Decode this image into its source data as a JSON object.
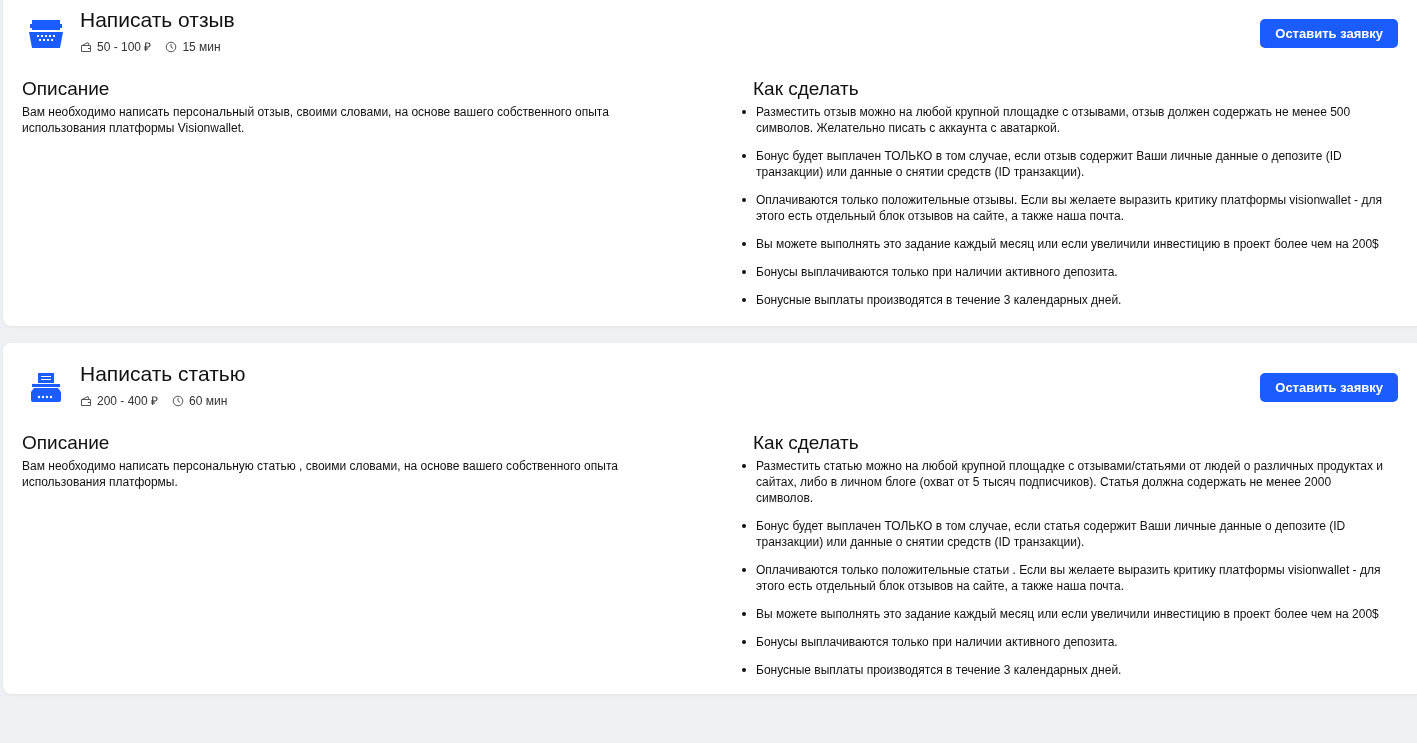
{
  "tasks": [
    {
      "icon": {
        "kind": "typewriter"
      },
      "title": "Написать отзыв",
      "reward": "50 - 100 ₽",
      "duration": "15 мин",
      "button": "Оставить заявку",
      "description_heading": "Описание",
      "description": "Вам необходимо написать персональный отзыв, своими словами, на основе вашего собственного опыта использования платформы Visionwallet.",
      "howto_heading": "Как сделать",
      "steps": [
        "Разместить отзыв можно на любой крупной площадке с отзывами, отзыв должен содержать не менее 500 символов. Желательно писать с аккаунта с аватаркой.",
        "Бонус будет выплачен ТОЛЬКО в том случае, если отзыв содержит Ваши личные данные о депозите (ID транзакции) или данные о снятии средств (ID транзакции).",
        "Оплачиваются только положительные отзывы. Если вы желаете выразить критику платформы visionwallet - для этого есть отдельный блок отзывов на сайте, а также наша почта.",
        "Вы можете выполнять это задание каждый месяц или если увеличили инвестицию в проект более чем на 200$",
        "Бонусы выплачиваются только при наличии активного депозита.",
        "Бонусные выплаты производятся в течение 3 календарных дней."
      ]
    },
    {
      "icon": {
        "kind": "printer"
      },
      "title": "Написать статью",
      "reward": "200 - 400 ₽",
      "duration": "60 мин",
      "button": "Оставить заявку",
      "description_heading": "Описание",
      "description": "Вам необходимо написать персональную статью , своими словами, на основе вашего собственного опыта использования платформы.",
      "howto_heading": "Как сделать",
      "steps": [
        "Разместить статью можно на любой крупной площадке с отзывами/статьями от людей о различных продуктах и сайтах, либо в личном блоге (охват от 5 тысяч подписчиков). Статья должна содержать не менее 2000 символов.",
        "Бонус будет выплачен ТОЛЬКО в том случае, если статья содержит Ваши личные данные о депозите (ID транзакции) или данные о снятии средств (ID транзакции).",
        "Оплачиваются только положительные статьи . Если вы желаете выразить критику платформы visionwallet - для этого есть отдельный блок отзывов на сайте, а также наша почта.",
        "Вы можете выполнять это задание каждый месяц или если увеличили инвестицию в проект более чем на 200$",
        "Бонусы выплачиваются только при наличии активного депозита.",
        "Бонусные выплаты производятся в течение 3 календарных дней."
      ]
    }
  ]
}
